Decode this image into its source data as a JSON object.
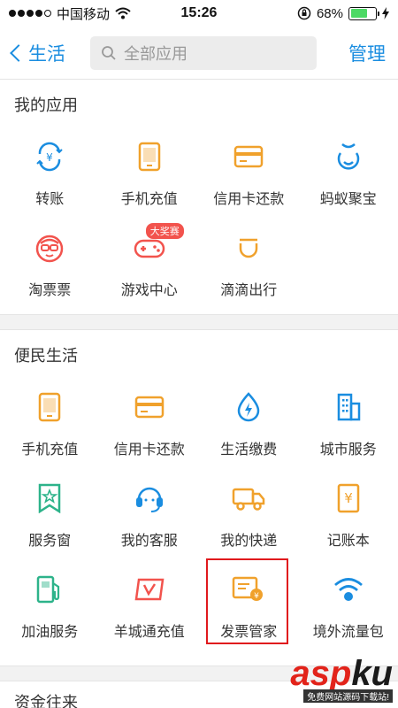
{
  "status_bar": {
    "carrier": "中国移动",
    "time": "15:26",
    "battery_percent": "68%",
    "battery_level": 0.68
  },
  "nav": {
    "back_label": "生活",
    "search_placeholder": "全部应用",
    "manage_label": "管理"
  },
  "my_apps": {
    "title": "我的应用",
    "items": [
      {
        "label": "转账",
        "icon": "transfer-icon"
      },
      {
        "label": "手机充值",
        "icon": "phone-icon"
      },
      {
        "label": "信用卡还款",
        "icon": "credit-card-icon"
      },
      {
        "label": "蚂蚁聚宝",
        "icon": "treasure-icon"
      },
      {
        "label": "淘票票",
        "icon": "ticket-mascot-icon"
      },
      {
        "label": "游戏中心",
        "icon": "gamepad-icon",
        "badge": "大奖赛"
      },
      {
        "label": "滴滴出行",
        "icon": "didi-icon"
      }
    ]
  },
  "convenience": {
    "title": "便民生活",
    "items": [
      {
        "label": "手机充值",
        "icon": "phone-icon"
      },
      {
        "label": "信用卡还款",
        "icon": "credit-card-icon"
      },
      {
        "label": "生活缴费",
        "icon": "bolt-icon"
      },
      {
        "label": "城市服务",
        "icon": "city-building-icon"
      },
      {
        "label": "服务窗",
        "icon": "bookmark-star-icon"
      },
      {
        "label": "我的客服",
        "icon": "headset-icon"
      },
      {
        "label": "我的快递",
        "icon": "truck-icon"
      },
      {
        "label": "记账本",
        "icon": "ledger-icon"
      },
      {
        "label": "加油服务",
        "icon": "fuel-pump-icon"
      },
      {
        "label": "羊城通充值",
        "icon": "yct-card-icon"
      },
      {
        "label": "发票管家",
        "icon": "invoice-icon"
      },
      {
        "label": "境外流量包",
        "icon": "wifi-globe-icon"
      }
    ]
  },
  "next_section": {
    "title": "资金往来"
  },
  "watermark": {
    "main_a": "asp",
    "main_k": "ku",
    "sub": "免费网站源码下载站!"
  },
  "colors": {
    "accent_blue": "#1a8de0",
    "orange": "#f0a12c",
    "red": "#f2534d",
    "green": "#2db38a",
    "highlight": "#e0191d"
  }
}
